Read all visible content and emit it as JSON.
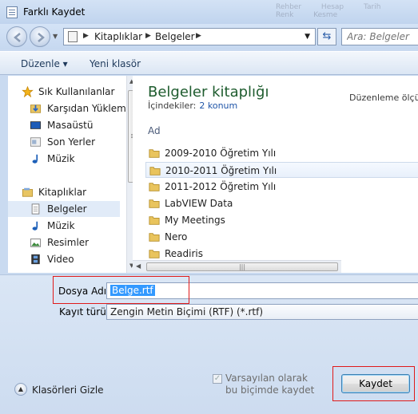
{
  "window": {
    "title": "Farklı Kaydet"
  },
  "faded_buttons": [
    "Rehber",
    "Hesap",
    "Tarih",
    "Renk",
    "Kesme"
  ],
  "address": {
    "crumbs": [
      "Kitaplıklar",
      "Belgeler"
    ],
    "search_placeholder": "Ara: Belgeler"
  },
  "toolbar": {
    "organize": "Düzenle ▾",
    "new_folder": "Yeni klasör"
  },
  "nav": {
    "favorites_header": "Sık Kullanılanlar",
    "favorites": [
      "Karşıdan Yüklem",
      "Masaüstü",
      "Son Yerler",
      "Müzik"
    ],
    "libraries_header": "Kitaplıklar",
    "libraries": [
      "Belgeler",
      "Müzik",
      "Resimler",
      "Video"
    ]
  },
  "library": {
    "title": "Belgeler kitaplığı",
    "includes_label": "İçindekiler:",
    "includes_link": "2 konum",
    "arrange_label": "Düzenleme ölçü",
    "column_name": "Ad"
  },
  "files": [
    "2009-2010 Öğretim Yılı",
    "2010-2011 Öğretim Yılı",
    "2011-2012 Öğretim Yılı",
    "LabVIEW Data",
    "My Meetings",
    "Nero",
    "Readiris"
  ],
  "form": {
    "filename_label": "Dosya Adı:",
    "filename_value": "Belge.rtf",
    "filetype_label": "Kayıt türü:",
    "filetype_value": "Zengin Metin Biçimi (RTF) (*.rtf)",
    "checkbox_label": "Varsayılan olarak bu biçimde kaydet",
    "hide_folders": "Klasörleri Gizle",
    "save_button": "Kaydet"
  },
  "colors": {
    "library_title": "#1e5c2e",
    "highlight": "#3399ff",
    "red_marker": "#e01a1a"
  }
}
